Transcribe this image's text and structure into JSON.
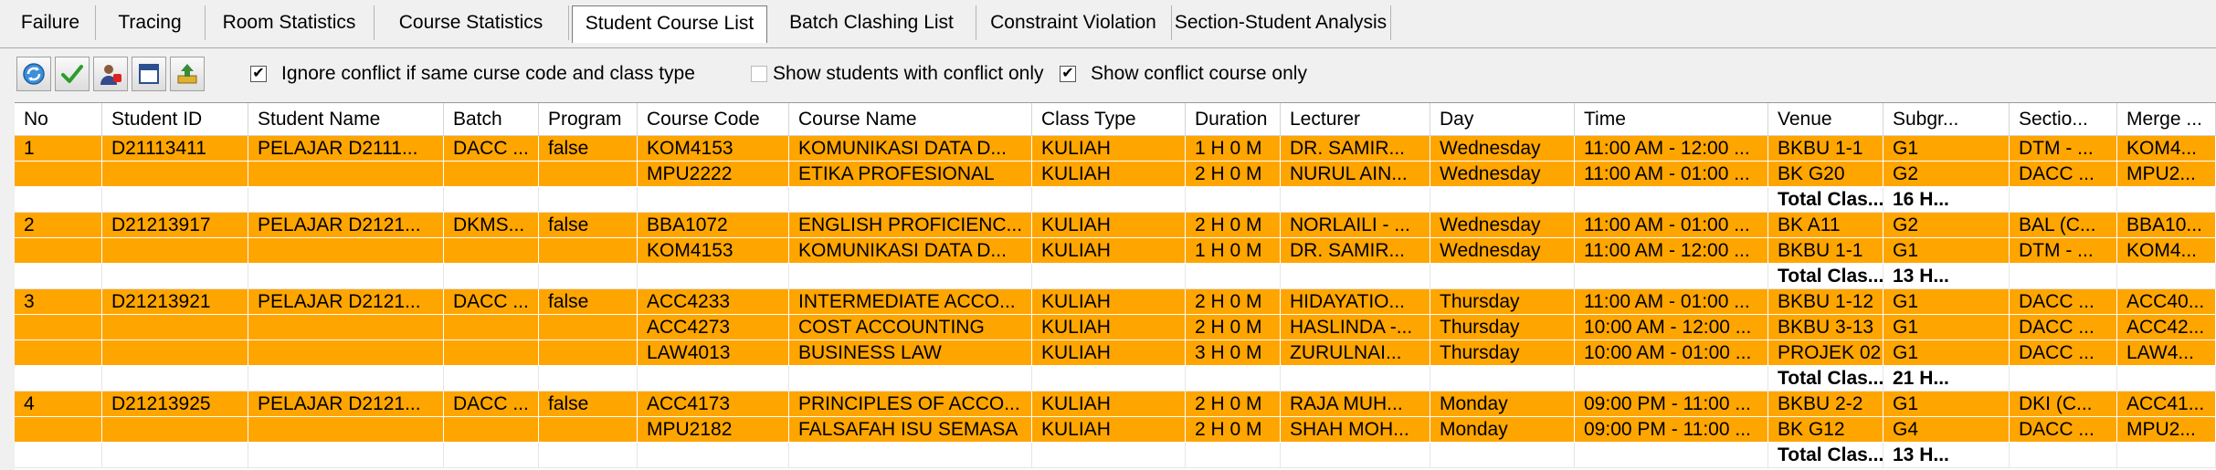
{
  "tabs": [
    {
      "label": "Failure"
    },
    {
      "label": "Tracing"
    },
    {
      "label": "Room Statistics"
    },
    {
      "label": "Course Statistics"
    },
    {
      "label": "Student Course List",
      "active": true
    },
    {
      "label": "Batch Clashing List"
    },
    {
      "label": "Constraint Violation"
    },
    {
      "label": "Section-Student Analysis"
    }
  ],
  "toolbar": {
    "buttons": [
      "refresh-icon",
      "check-icon",
      "user-icon",
      "window-icon",
      "export-icon"
    ],
    "ignore_conflict": {
      "label": "Ignore conflict if same curse code and class type",
      "checked": true
    },
    "show_students_conflict": {
      "label": "Show students with conflict only",
      "checked": false
    },
    "show_conflict_course": {
      "label": "Show conflict course only",
      "checked": true
    }
  },
  "grid": {
    "highlight_color": "#ffa500",
    "columns": [
      "No",
      "Student ID",
      "Student Name",
      "Batch",
      "Program",
      "Course Code",
      "Course Name",
      "Class Type",
      "Duration",
      "Lecturer",
      "Day",
      "Time",
      "Venue",
      "Subgr...",
      "Sectio...",
      "Merge ..."
    ],
    "rows": [
      {
        "type": "data",
        "cells": [
          "1",
          "D21113411",
          "PELAJAR D2111...",
          "DACC ...",
          "false",
          "KOM4153",
          "KOMUNIKASI DATA D...",
          "KULIAH",
          "1 H 0 M",
          "DR. SAMIR...",
          "Wednesday",
          "11:00 AM - 12:00 ...",
          "BKBU 1-1",
          "G1",
          "DTM - ...",
          "KOM4..."
        ]
      },
      {
        "type": "data",
        "cells": [
          "",
          "",
          "",
          "",
          "",
          "MPU2222",
          "ETIKA PROFESIONAL",
          "KULIAH",
          "2 H 0 M",
          "NURUL AIN...",
          "Wednesday",
          "11:00 AM - 01:00 ...",
          "BK G20",
          "G2",
          "DACC ...",
          "MPU2..."
        ]
      },
      {
        "type": "total",
        "label": "Total Clas...",
        "value": "16 H..."
      },
      {
        "type": "data",
        "cells": [
          "2",
          "D21213917",
          "PELAJAR D2121...",
          "DKMS...",
          "false",
          "BBA1072",
          "ENGLISH PROFICIENC...",
          "KULIAH",
          "2 H 0 M",
          "NORLAILI - ...",
          "Wednesday",
          "11:00 AM - 01:00 ...",
          "BK A11",
          "G2",
          "BAL (C...",
          "BBA10..."
        ]
      },
      {
        "type": "data",
        "cells": [
          "",
          "",
          "",
          "",
          "",
          "KOM4153",
          "KOMUNIKASI DATA D...",
          "KULIAH",
          "1 H 0 M",
          "DR. SAMIR...",
          "Wednesday",
          "11:00 AM - 12:00 ...",
          "BKBU 1-1",
          "G1",
          "DTM - ...",
          "KOM4..."
        ]
      },
      {
        "type": "total",
        "label": "Total Clas...",
        "value": "13 H..."
      },
      {
        "type": "data",
        "cells": [
          "3",
          "D21213921",
          "PELAJAR D2121...",
          "DACC ...",
          "false",
          "ACC4233",
          "INTERMEDIATE ACCO...",
          "KULIAH",
          "2 H 0 M",
          "HIDAYATIO...",
          "Thursday",
          "11:00 AM - 01:00 ...",
          "BKBU 1-12",
          "G1",
          "DACC ...",
          "ACC40..."
        ]
      },
      {
        "type": "data",
        "cells": [
          "",
          "",
          "",
          "",
          "",
          "ACC4273",
          "COST ACCOUNTING",
          "KULIAH",
          "2 H 0 M",
          "HASLINDA -...",
          "Thursday",
          "10:00 AM - 12:00 ...",
          "BKBU 3-13",
          "G1",
          "DACC ...",
          "ACC42..."
        ]
      },
      {
        "type": "data",
        "cells": [
          "",
          "",
          "",
          "",
          "",
          "LAW4013",
          "BUSINESS LAW",
          "KULIAH",
          "3 H 0 M",
          "ZURULNAI...",
          "Thursday",
          "10:00 AM - 01:00 ...",
          "PROJEK 02",
          "G1",
          "DACC ...",
          "LAW4..."
        ]
      },
      {
        "type": "total",
        "label": "Total Clas...",
        "value": "21 H..."
      },
      {
        "type": "data",
        "cells": [
          "4",
          "D21213925",
          "PELAJAR D2121...",
          "DACC ...",
          "false",
          "ACC4173",
          "PRINCIPLES OF ACCO...",
          "KULIAH",
          "2 H 0 M",
          "RAJA MUH...",
          "Monday",
          "09:00 PM - 11:00 ...",
          "BKBU 2-2",
          "G1",
          "DKI (C...",
          "ACC41..."
        ]
      },
      {
        "type": "data",
        "cells": [
          "",
          "",
          "",
          "",
          "",
          "MPU2182",
          "FALSAFAH ISU SEMASA",
          "KULIAH",
          "2 H 0 M",
          "SHAH MOH...",
          "Monday",
          "09:00 PM - 11:00 ...",
          "BK G12",
          "G4",
          "DACC ...",
          "MPU2..."
        ]
      },
      {
        "type": "total",
        "label": "Total Clas...",
        "value": "13 H..."
      }
    ]
  }
}
